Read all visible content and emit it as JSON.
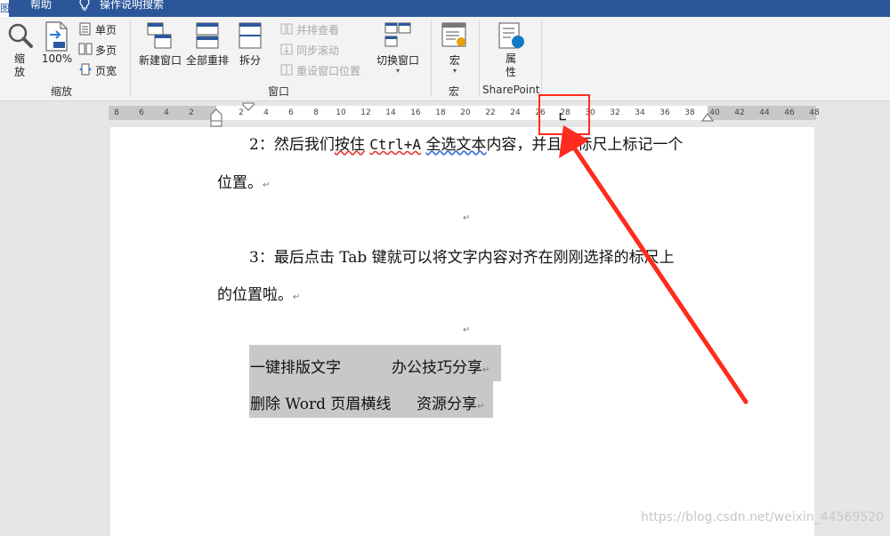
{
  "titlebar": {
    "left_tab": "图",
    "help_tab": "帮助",
    "search_label": "操作说明搜索"
  },
  "ribbon": {
    "zoom_group": {
      "zoom_label_1": "缩",
      "zoom_label_2": "放",
      "percent": "100%",
      "single_page": "单页",
      "multi_page": "多页",
      "page_width": "页宽",
      "group_label": "缩放"
    },
    "window_group": {
      "new_window": "新建窗口",
      "arrange_all": "全部重排",
      "split": "拆分",
      "side_by_side": "并排查看",
      "sync_scroll": "同步滚动",
      "reset_position": "重设窗口位置",
      "switch_windows": "切换窗口",
      "group_label": "窗口"
    },
    "macro_group": {
      "macros": "宏",
      "group_label": "宏"
    },
    "sharepoint_group": {
      "properties_1": "属",
      "properties_2": "性",
      "group_label": "SharePoint"
    }
  },
  "ruler": {
    "numbers": [
      "8",
      "6",
      "4",
      "2",
      "2",
      "4",
      "6",
      "8",
      "10",
      "12",
      "14",
      "16",
      "18",
      "20",
      "22",
      "24",
      "26",
      "28",
      "30",
      "32",
      "34",
      "36",
      "38",
      "40",
      "42",
      "44",
      "46",
      "48"
    ]
  },
  "document": {
    "para2_line1_a": "2：然后我们",
    "para2_line1_b": "按住",
    "para2_line1_c": "Ctrl+A",
    "para2_line1_d": "全选文本",
    "para2_line1_e": "内容，并且在标尺上标记一个",
    "para2_line2": "位置。",
    "para3_line1": "3：最后点击 Tab 键就可以将文字内容对齐在刚刚选择的标尺上",
    "para3_line2": "的位置啦。",
    "row1_left": "一键排版文字",
    "row1_right": "办公技巧分享",
    "row2_left": "删除 Word 页眉横线",
    "row2_right": "资源分享",
    "para_mark": "↵"
  },
  "watermark": "https://blog.csdn.net/weixin_44569520",
  "colors": {
    "title_bar": "#2b579a",
    "annotation": "#ff2b1e",
    "selection": "#c8c8c8"
  }
}
